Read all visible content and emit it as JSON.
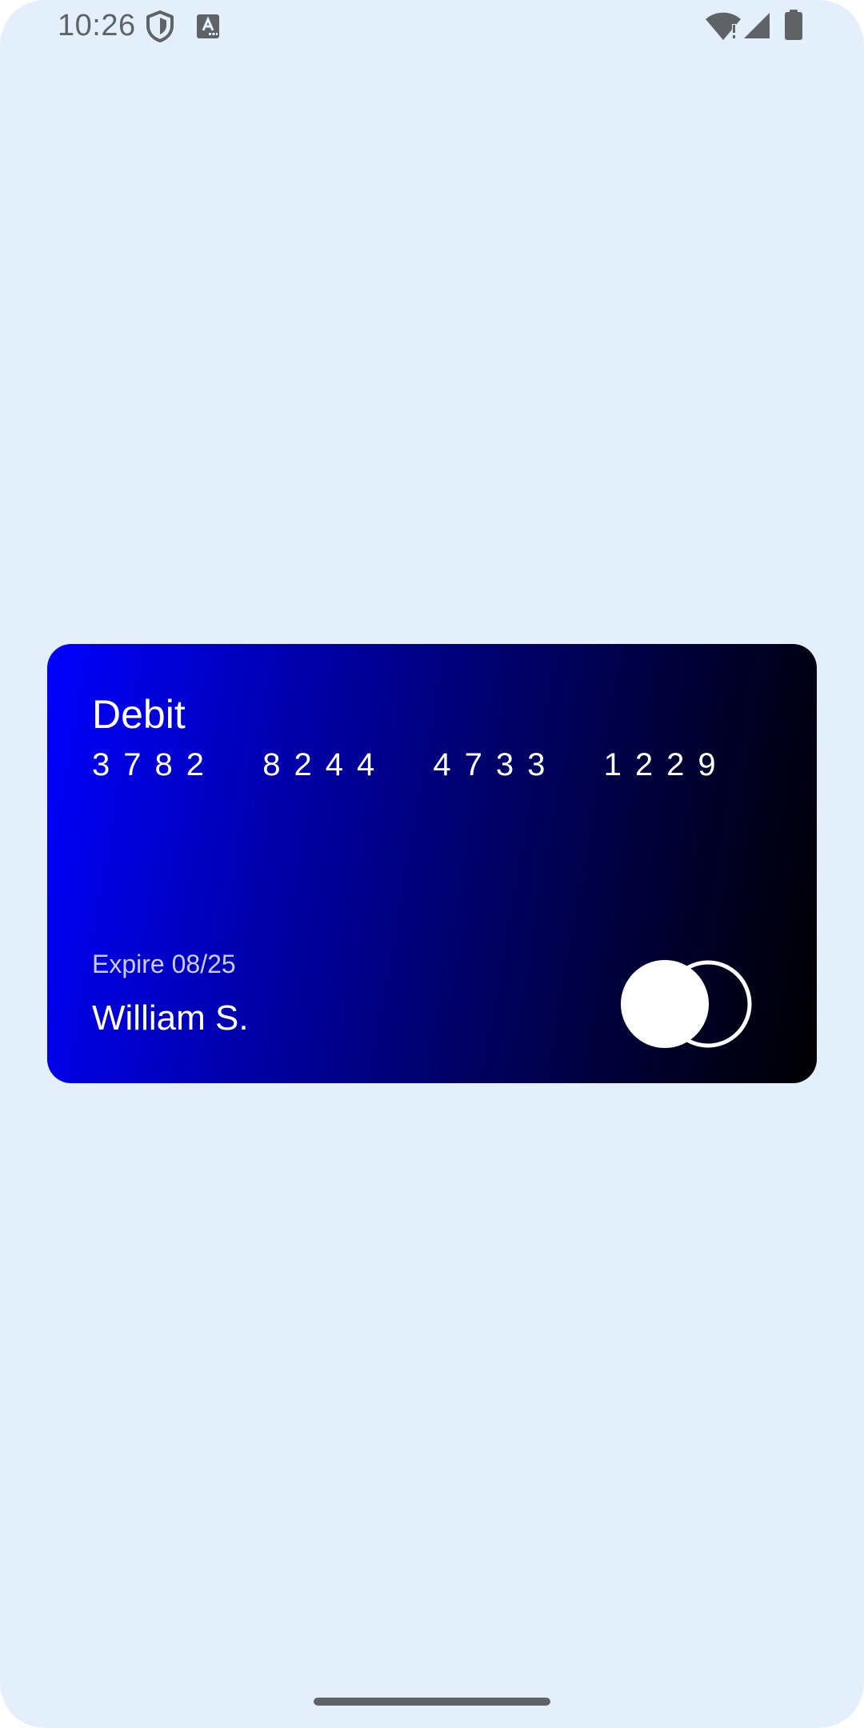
{
  "status_bar": {
    "time": "10:26",
    "icons": [
      "shield-icon",
      "keyboard-a-icon",
      "wifi-alert-icon",
      "signal-icon",
      "battery-icon"
    ]
  },
  "card": {
    "type": "Debit",
    "number": "3782  8244  4733  1229",
    "expiry": "Expire 08/25",
    "holder": "William S.",
    "brand_icon": "card-network-logo",
    "gradient_start": "#0000ff",
    "gradient_end": "#000000"
  },
  "colors": {
    "background": "#e3f0fc",
    "status_icon": "#5f6368"
  }
}
